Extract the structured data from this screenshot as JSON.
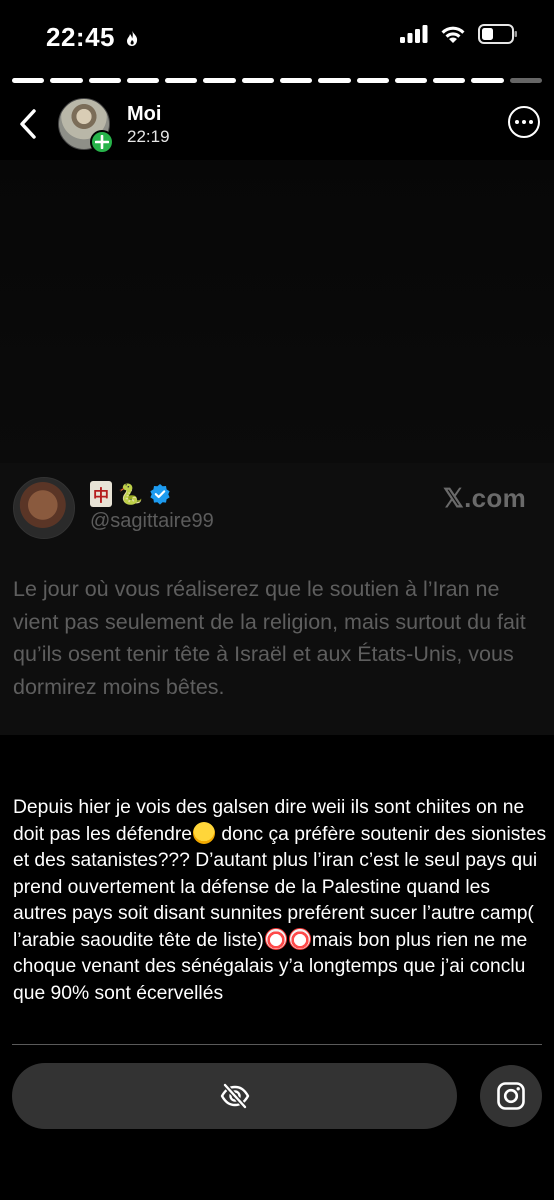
{
  "status_bar": {
    "time": "22:45",
    "icons": [
      "flame-icon",
      "signal-icon",
      "wifi-icon",
      "battery-icon"
    ]
  },
  "story": {
    "segments_viewed": 13,
    "segments_total": 14
  },
  "header": {
    "name": "Moi",
    "time": "22:19"
  },
  "tweet": {
    "handle": "@sagittaire99",
    "emojis": [
      "mahjong-red-dragon",
      "snake",
      "verified-badge"
    ],
    "brand": "𝕏.com",
    "text": "Le jour où vous réaliserez que le soutien à l’Iran ne vient pas seulement de la religion, mais surtout du fait qu’ils osent tenir tête à Israël et aux États-Unis, vous dormirez moins bêtes."
  },
  "caption": {
    "part1": "Depuis hier je vois des galsen dire weii ils sont chiites on ne doit pas les défendre",
    "part2": " donc ça préfère soutenir des sionistes et des satanistes??? D’autant plus l’iran c’est le seul pays qui prend ouvertement la défense de la Palestine quand les autres pays soit disant sunnites preférent sucer l’autre camp( l’arabie saoudite tête de liste)",
    "part3": "mais bon plus rien ne me choque venant des sénégalais y’a longtemps que j’ai conclu que 90% sont écervellés",
    "emoji1": "laughing-tears-emoji",
    "emoji2": "clown-emoji"
  },
  "footer": {
    "reply_icon": "eye-slash-icon",
    "share_icon": "instagram-icon"
  },
  "colors": {
    "background": "#000000",
    "card": "#0e0e0e",
    "muted_text": "#5e5e5e",
    "badge_green": "#27b34a",
    "verified_blue": "#1d9bf0"
  }
}
